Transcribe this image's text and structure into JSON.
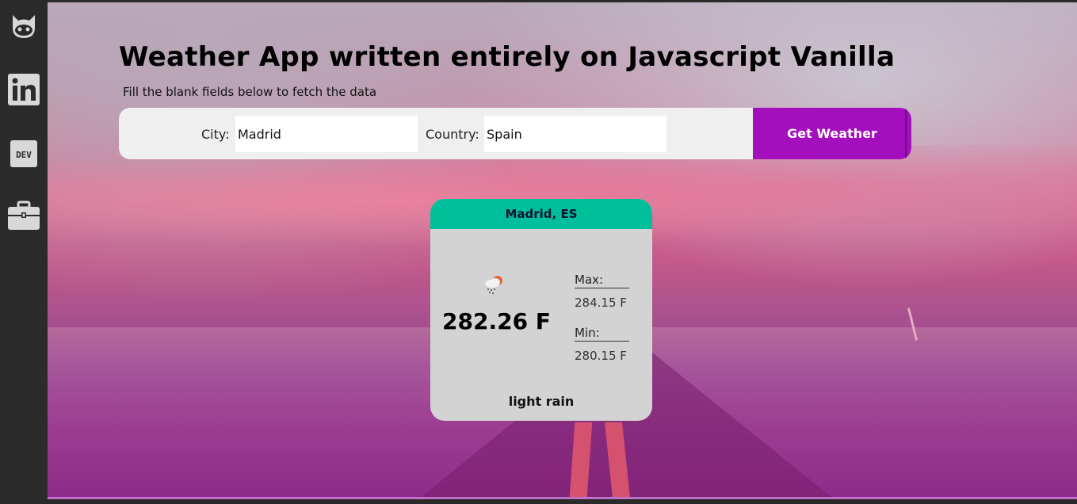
{
  "sidebar": {
    "icons": [
      "github-icon",
      "linkedin-icon",
      "dev-icon",
      "briefcase-icon"
    ],
    "dev_badge": "DEV"
  },
  "header": {
    "title": "Weather App written entirely on Javascript Vanilla",
    "subtitle": "Fill the blank fields below to fetch the data"
  },
  "form": {
    "city_label": "City:",
    "city_value": "Madrid",
    "country_label": "Country:",
    "country_value": "Spain",
    "submit_label": "Get Weather"
  },
  "weather_card": {
    "location": "Madrid, ES",
    "icon": "rain-cloud-sun-icon",
    "temperature": "282.26 F",
    "max_label": "Max:",
    "max_value": "284.15 F",
    "min_label": "Min:",
    "min_value": "280.15 F",
    "description": "light rain"
  },
  "colors": {
    "sidebar": "#2b2b2b",
    "button": "#a30fbd",
    "card_header": "#00bf9a",
    "card_body": "#d3d3d3"
  }
}
